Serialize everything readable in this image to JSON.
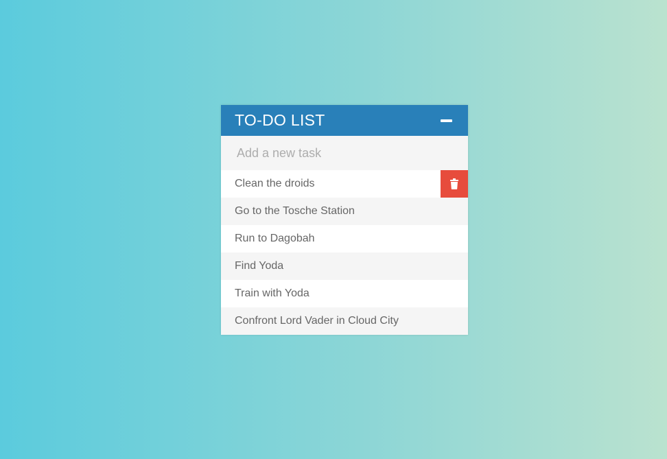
{
  "todo": {
    "title": "TO-DO LIST",
    "input_placeholder": "Add a new task",
    "input_value": "",
    "tasks": [
      {
        "text": "Clean the droids",
        "show_delete": true
      },
      {
        "text": "Go to the Tosche Station",
        "show_delete": false
      },
      {
        "text": "Run to Dagobah",
        "show_delete": false
      },
      {
        "text": "Find Yoda",
        "show_delete": false
      },
      {
        "text": "Train with Yoda",
        "show_delete": false
      },
      {
        "text": "Confront Lord Vader in Cloud City",
        "show_delete": false
      }
    ]
  },
  "icons": {
    "collapse": "minus-icon",
    "delete": "trash-icon"
  },
  "colors": {
    "header": "#2980b9",
    "delete": "#e74c3c",
    "background_start": "#5bcbdd",
    "background_end": "#bae2cf"
  }
}
